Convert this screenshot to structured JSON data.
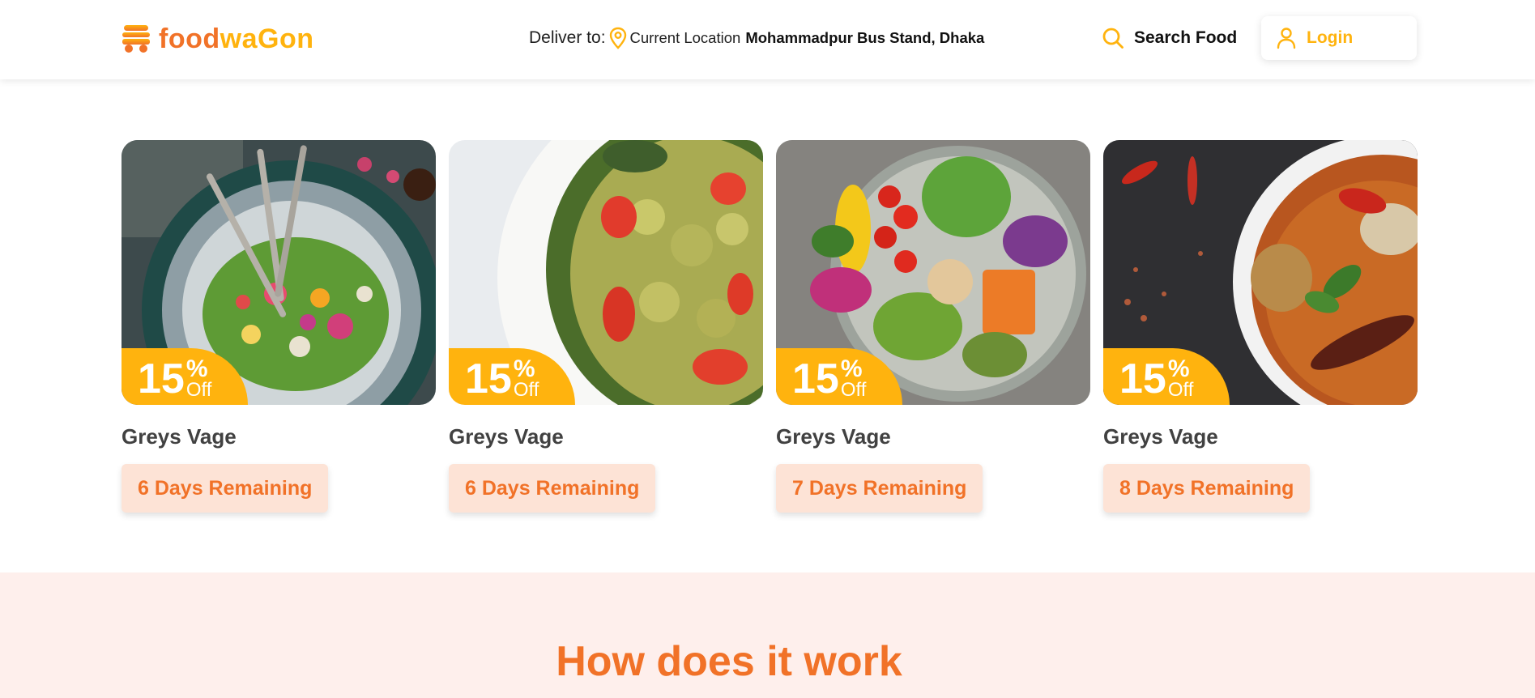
{
  "header": {
    "logo": {
      "part1": "food",
      "part2": "waGon"
    },
    "deliver": {
      "label": "Deliver to:",
      "current_location": "Current Location",
      "address": "Mohammadpur Bus Stand, Dhaka"
    },
    "search_label": "Search Food",
    "login_label": "Login"
  },
  "deals": [
    {
      "title": "Greys Vage",
      "discount": "15",
      "pct": "%",
      "off": "Off",
      "remaining": "6 Days Remaining",
      "image": "salad-bowl-flowers"
    },
    {
      "title": "Greys Vage",
      "discount": "15",
      "pct": "%",
      "off": "Off",
      "remaining": "6 Days Remaining",
      "image": "pesto-pasta"
    },
    {
      "title": "Greys Vage",
      "discount": "15",
      "pct": "%",
      "off": "Off",
      "remaining": "7 Days Remaining",
      "image": "buddha-bowl"
    },
    {
      "title": "Greys Vage",
      "discount": "15",
      "pct": "%",
      "off": "Off",
      "remaining": "8 Days Remaining",
      "image": "curry-bowl"
    }
  ],
  "how": {
    "title": "How does it work"
  },
  "colors": {
    "primary": "#f17228",
    "accent": "#ffb30e",
    "pink_bg": "#feefec"
  }
}
